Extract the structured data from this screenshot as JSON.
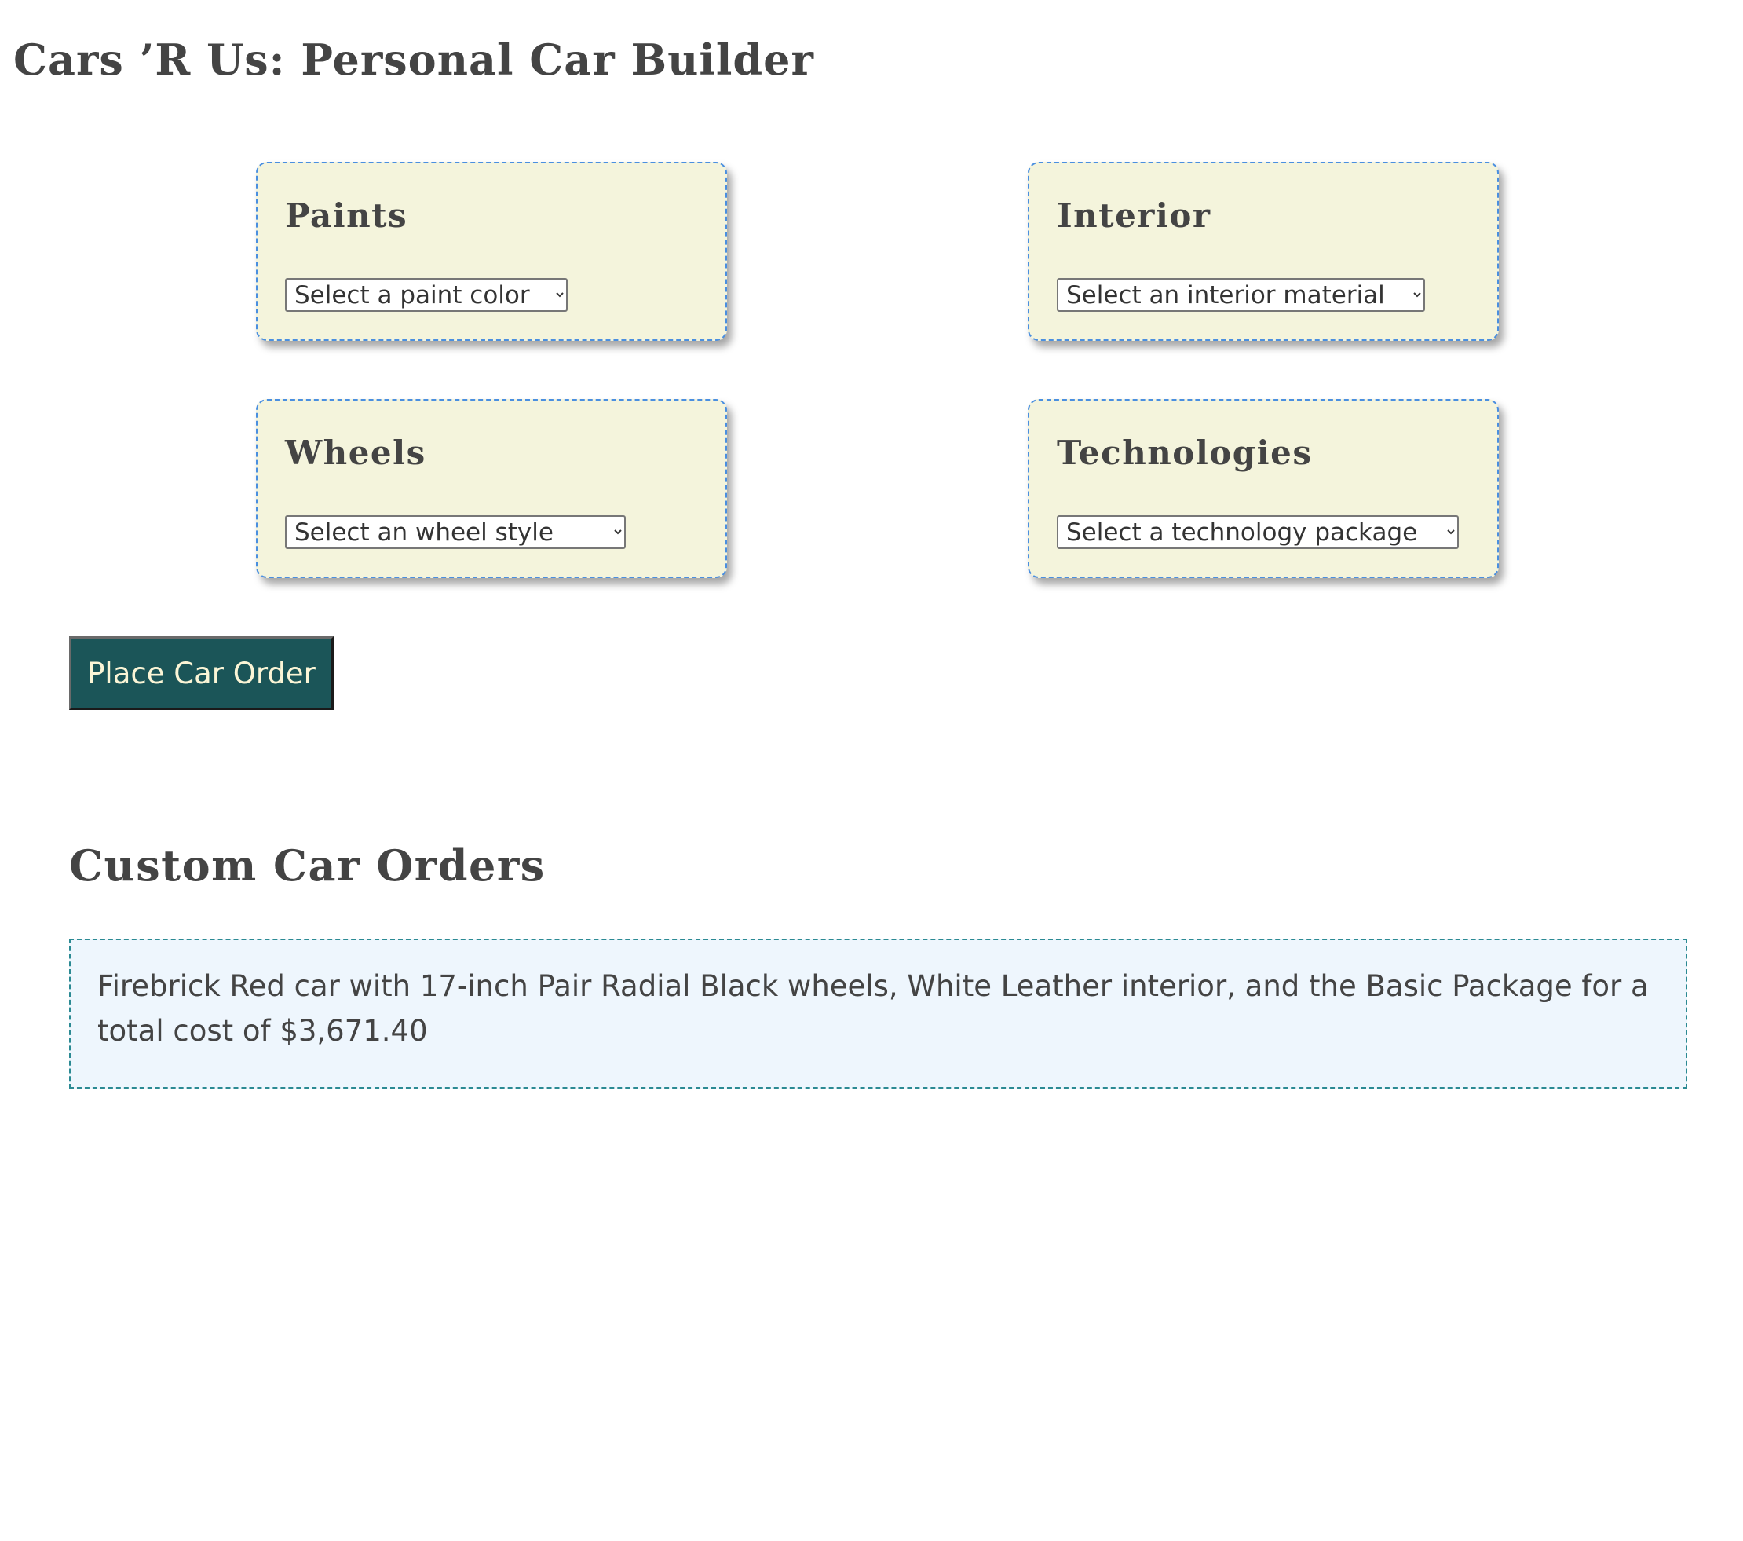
{
  "header": {
    "title": "Cars ’R Us: Personal Car Builder"
  },
  "cards": [
    {
      "heading": "Paints",
      "select": "Select a paint color"
    },
    {
      "heading": "Interior",
      "select": "Select an interior material"
    },
    {
      "heading": "Wheels",
      "select": "Select an wheel style"
    },
    {
      "heading": "Technologies",
      "select": "Select a technology package"
    }
  ],
  "order_button": "Place Car Order",
  "orders": {
    "heading": "Custom Car Orders",
    "items": [
      "Firebrick Red car with 17-inch Pair Radial Black wheels, White Leather interior, and the Basic Package for a total cost of $3,671.40"
    ]
  },
  "colors": {
    "card_bg": "#f4f4dc",
    "card_border": "#4a8fe0",
    "button_bg": "#1b5558",
    "orders_bg": "#eef6fd",
    "orders_border": "#2b8a93"
  }
}
